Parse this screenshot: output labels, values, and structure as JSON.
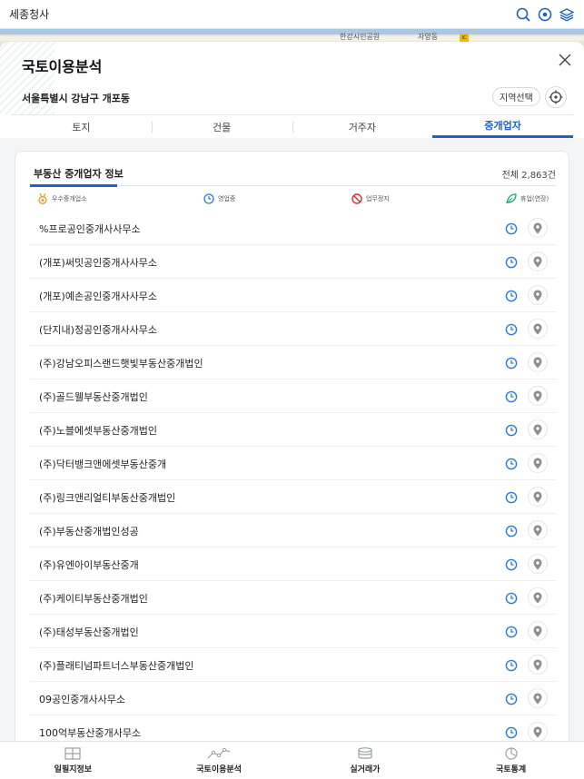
{
  "topbar": {
    "title": "세종청사"
  },
  "map": {
    "label1": "한강시민공원",
    "label2": "자양동",
    "ic_label": "IC"
  },
  "panel": {
    "title": "국토이용분석",
    "region": "서울특별시 강남구 개포동",
    "region_button": "지역선택"
  },
  "tabs": [
    {
      "label": "토지",
      "active": false
    },
    {
      "label": "건물",
      "active": false
    },
    {
      "label": "거주자",
      "active": false
    },
    {
      "label": "중개업자",
      "active": true
    }
  ],
  "card": {
    "title": "부동산 중개업자 정보",
    "count": "전체 2,863건"
  },
  "legend": [
    {
      "label": "우수중개업소",
      "icon": "medal-icon",
      "color": "#f29a1f"
    },
    {
      "label": "영업중",
      "icon": "clock-icon",
      "color": "#2b7bd6"
    },
    {
      "label": "업무정지",
      "icon": "prohibited-icon",
      "color": "#d9302b"
    },
    {
      "label": "휴업(연장)",
      "icon": "leaf-icon",
      "color": "#22a56b"
    }
  ],
  "agents": [
    {
      "name": "%프로공인중개사사무소"
    },
    {
      "name": "(개포)써밋공인중개사사무소"
    },
    {
      "name": "(개포)예손공인중개사사무소"
    },
    {
      "name": "(단지내)정공인중개사사무소"
    },
    {
      "name": "(주)강남오피스랜드햇빛부동산중개법인"
    },
    {
      "name": "(주)골드웰부동산중개법인"
    },
    {
      "name": "(주)노블에셋부동산중개법인"
    },
    {
      "name": "(주)닥터뱅크앤에셋부동산중개"
    },
    {
      "name": "(주)링크앤리얼티부동산중개법인"
    },
    {
      "name": "(주)부동산중개법인성공"
    },
    {
      "name": "(주)유엔아이부동산중개"
    },
    {
      "name": "(주)케이티부동산중개법인"
    },
    {
      "name": "(주)태성부동산중개법인"
    },
    {
      "name": "(주)플래티넘파트너스부동산중개법인"
    },
    {
      "name": "09공인중개사사무소"
    },
    {
      "name": "100억부동산중개사무소"
    }
  ],
  "bottom_nav": [
    {
      "label": "일필지정보",
      "icon": "map-grid-icon"
    },
    {
      "label": "국토이용분석",
      "icon": "trend-line-icon"
    },
    {
      "label": "실거래가",
      "icon": "coins-icon"
    },
    {
      "label": "국토통계",
      "icon": "pie-chart-icon"
    }
  ],
  "colors": {
    "accent": "#1d63c7",
    "status_open": "#2b7bd6",
    "pin": "#8a8f96"
  }
}
